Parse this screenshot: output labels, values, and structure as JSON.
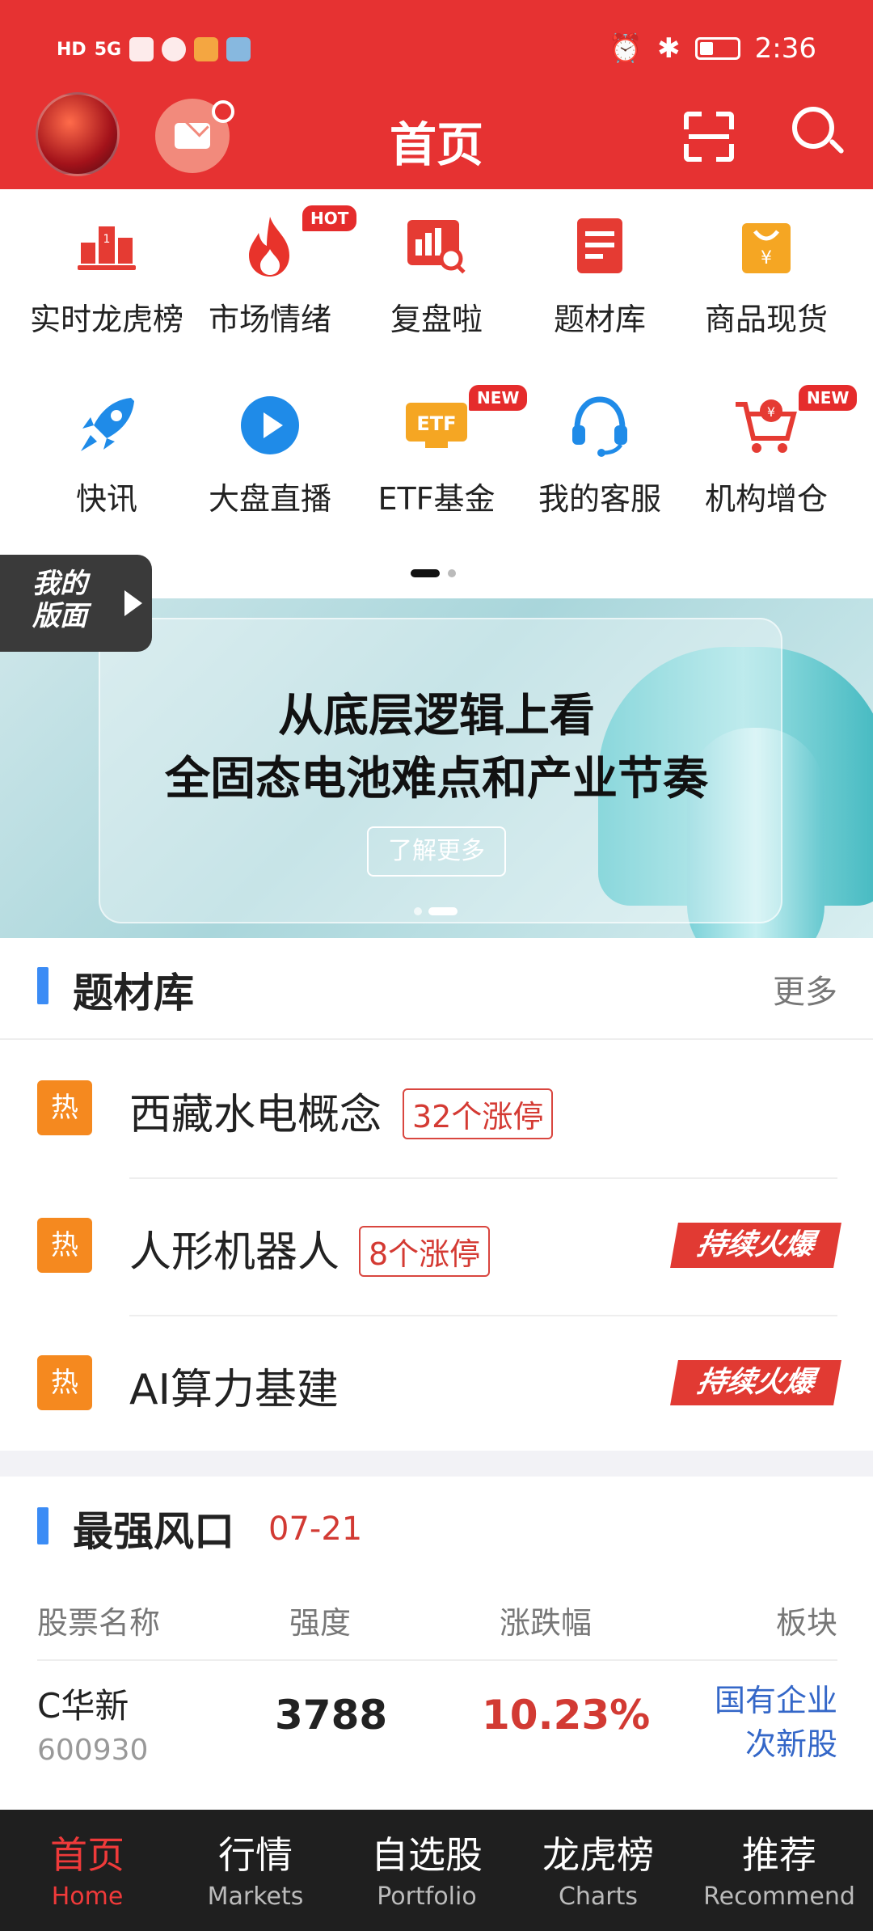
{
  "status_bar": {
    "time": "2:36",
    "network": "5G"
  },
  "header": {
    "title": "首页"
  },
  "quick_grid": {
    "items": [
      {
        "label": "实时龙虎榜",
        "icon": "podium-icon"
      },
      {
        "label": "市场情绪",
        "icon": "flame-icon",
        "badge": "HOT"
      },
      {
        "label": "复盘啦",
        "icon": "chart-magnifier-icon"
      },
      {
        "label": "题材库",
        "icon": "document-icon"
      },
      {
        "label": "商品现货",
        "icon": "shopping-bag-icon"
      },
      {
        "label": "快讯",
        "icon": "rocket-icon"
      },
      {
        "label": "大盘直播",
        "icon": "play-icon"
      },
      {
        "label": "ETF基金",
        "icon": "etf-icon",
        "badge": "NEW"
      },
      {
        "label": "我的客服",
        "icon": "headset-icon"
      },
      {
        "label": "机构增仓",
        "icon": "cart-icon",
        "badge": "NEW"
      }
    ]
  },
  "my_panel": {
    "line1": "我的",
    "line2": "版面"
  },
  "banner": {
    "line1": "从底层逻辑上看",
    "line2": "全固态电池难点和产业节奏",
    "cta": "了解更多"
  },
  "topics": {
    "title": "题材库",
    "more": "更多",
    "hot_label": "热",
    "rows": [
      {
        "name": "西藏水电概念",
        "limit_up": "32个涨停",
        "tag": ""
      },
      {
        "name": "人形机器人",
        "limit_up": "8个涨停",
        "tag": "持续火爆"
      },
      {
        "name": "AI算力基建",
        "limit_up": "",
        "tag": "持续火爆"
      }
    ]
  },
  "strongest": {
    "title": "最强风口",
    "date": "07-21",
    "headers": [
      "股票名称",
      "强度",
      "涨跌幅",
      "板块"
    ],
    "rows": [
      {
        "name": "C华新",
        "code": "600930",
        "strength": "3788",
        "change": "10.23%",
        "sector_line1": "国有企业",
        "sector_line2": "次新股"
      }
    ]
  },
  "tabbar": {
    "tabs": [
      {
        "zh": "首页",
        "en": "Home"
      },
      {
        "zh": "行情",
        "en": "Markets"
      },
      {
        "zh": "自选股",
        "en": "Portfolio"
      },
      {
        "zh": "龙虎榜",
        "en": "Charts"
      },
      {
        "zh": "推荐",
        "en": "Recommend"
      }
    ],
    "active_index": 0
  },
  "colors": {
    "brand_red": "#e63232",
    "hot_orange": "#f5891f",
    "accent_blue": "#3b8cf5"
  }
}
